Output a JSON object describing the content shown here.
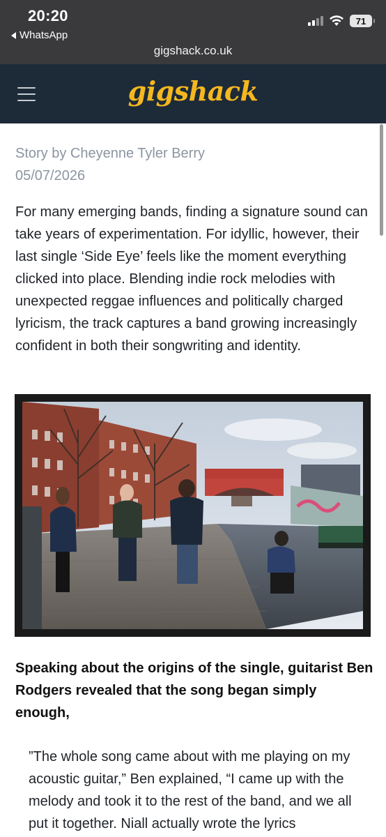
{
  "status_bar": {
    "time": "20:20",
    "back_app": "WhatsApp",
    "battery": "71"
  },
  "browser": {
    "url": "gigshack.co.uk"
  },
  "site": {
    "logo": "gigshack",
    "brand_color": "#f4b81f",
    "header_bg": "#1d2a38"
  },
  "article": {
    "byline": "Story by Cheyenne Tyler Berry",
    "date": "05/07/2026",
    "intro": "For many emerging bands, finding a signature sound can take years of experimentation. For idyllic, however, their last single ‘Side Eye’ feels like the moment everything clicked into place. Blending indie rock melodies with unexpected reggae influences and politically charged lyricism, the track captures a band growing increasingly confident in both their songwriting and identity.",
    "lead_in": "Speaking about the origins of the single, guitarist Ben Rodgers revealed that the song began simply enough,",
    "quote": "”The whole song came about with me playing on my acoustic guitar,” Ben explained, “I came up with the melody and took it to the rest of the band, and we all put it together. Niall actually wrote the lyrics"
  }
}
